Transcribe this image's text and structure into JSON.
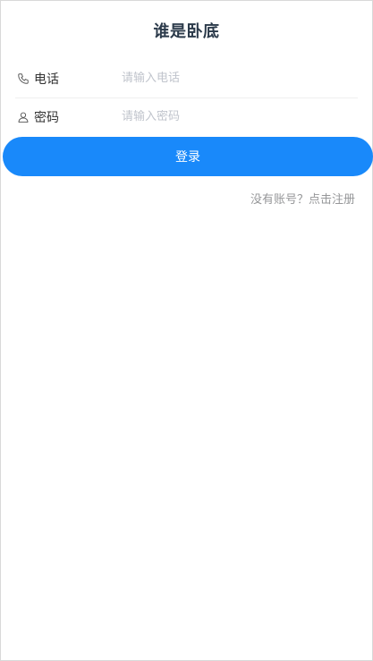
{
  "header": {
    "title": "谁是卧底"
  },
  "form": {
    "phone": {
      "icon": "phone-icon",
      "label": "电话",
      "placeholder": "请输入电话",
      "value": ""
    },
    "password": {
      "icon": "user-icon",
      "label": "密码",
      "placeholder": "请输入密码",
      "value": ""
    },
    "login_label": "登录"
  },
  "footer": {
    "register_link": "没有账号？点击注册"
  },
  "colors": {
    "primary": "#1989fa",
    "title_text": "#2b3a4a",
    "placeholder": "#c0c4cc",
    "link": "#969799"
  }
}
